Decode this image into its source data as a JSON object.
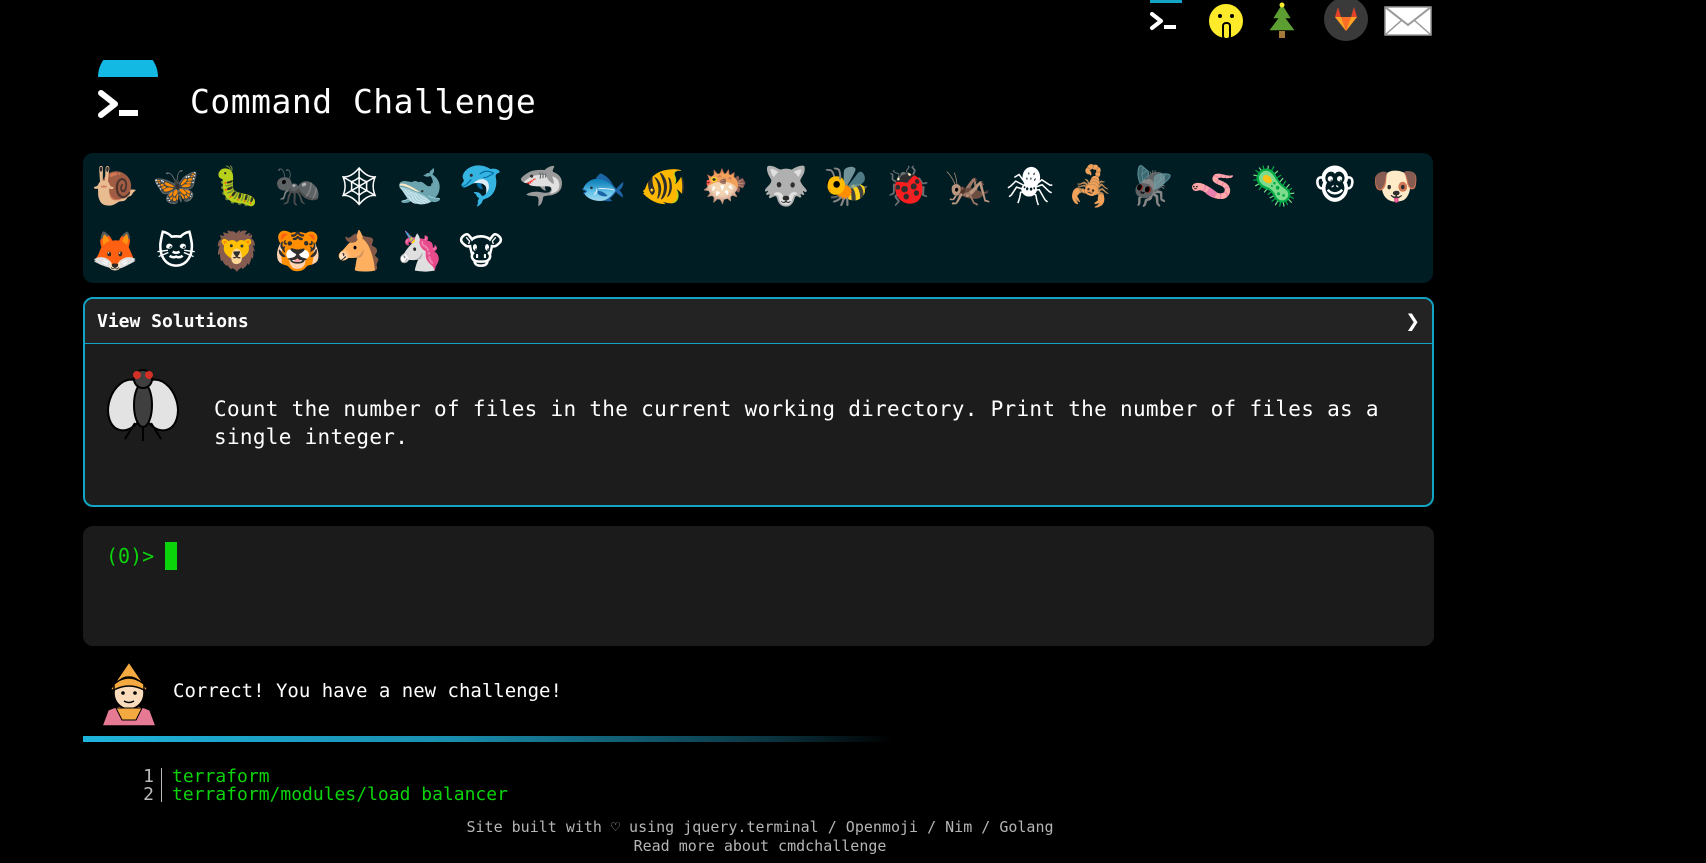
{
  "site": {
    "title": "Command Challenge"
  },
  "topnav": [
    {
      "name": "terminal-icon",
      "glyph": ""
    },
    {
      "name": "shushing-face-icon",
      "glyph": "🤭"
    },
    {
      "name": "christmas-tree-icon",
      "glyph": "🎄"
    },
    {
      "name": "gitlab-icon",
      "glyph": ""
    },
    {
      "name": "envelope-icon",
      "glyph": "✉"
    }
  ],
  "critters": [
    {
      "name": "snail-icon",
      "glyph": "🐌"
    },
    {
      "name": "butterfly-icon",
      "glyph": "🦋"
    },
    {
      "name": "caterpillar-icon",
      "glyph": "🐛"
    },
    {
      "name": "ant-icon",
      "glyph": "🐜"
    },
    {
      "name": "spider-web-icon",
      "glyph": "🕸"
    },
    {
      "name": "whale-icon",
      "glyph": "🐋"
    },
    {
      "name": "dolphin-icon",
      "glyph": "🐬"
    },
    {
      "name": "shark-icon",
      "glyph": "🦈"
    },
    {
      "name": "fish-icon",
      "glyph": "🐟"
    },
    {
      "name": "tropical-fish-icon",
      "glyph": "🐠"
    },
    {
      "name": "blowfish-icon",
      "glyph": "🐡"
    },
    {
      "name": "wolf-icon",
      "glyph": "🐺"
    },
    {
      "name": "bee-icon",
      "glyph": "🐝"
    },
    {
      "name": "ladybug-icon",
      "glyph": "🐞"
    },
    {
      "name": "cricket-icon",
      "glyph": "🦗"
    },
    {
      "name": "spider-icon",
      "glyph": "🕷"
    },
    {
      "name": "scorpion-icon",
      "glyph": "🦂"
    },
    {
      "name": "fly-icon",
      "glyph": "🪰"
    },
    {
      "name": "worm-icon",
      "glyph": "🪱"
    },
    {
      "name": "microbe-icon",
      "glyph": "🦠"
    },
    {
      "name": "monkey-icon",
      "glyph": "🐵"
    },
    {
      "name": "dog-icon",
      "glyph": "🐶"
    },
    {
      "name": "fox-icon",
      "glyph": "🦊"
    },
    {
      "name": "cat-icon",
      "glyph": "🐱"
    },
    {
      "name": "lion-icon",
      "glyph": "🦁"
    },
    {
      "name": "tiger-icon",
      "glyph": "🐯"
    },
    {
      "name": "horse-icon",
      "glyph": "🐴"
    },
    {
      "name": "unicorn-icon",
      "glyph": "🦄"
    },
    {
      "name": "cow-icon",
      "glyph": "🐮"
    }
  ],
  "challenge": {
    "header": "View Solutions",
    "chevron": "❯",
    "icon": "fly-icon",
    "description": "Count the number of files in the current working directory. Print the number of files as a single integer."
  },
  "terminal": {
    "prompt": "(0)>"
  },
  "notification": {
    "avatar": "elf-icon",
    "message": "Correct! You have a new challenge!",
    "progress": 0.66
  },
  "listing": [
    {
      "n": "1",
      "text": "terraform"
    },
    {
      "n": "2",
      "text": "terraform/modules/load_balancer"
    }
  ],
  "footer": {
    "prefix": "Site built with ♡ using",
    "links": [
      "jquery.terminal",
      "Openmoji",
      "Nim",
      "Golang"
    ],
    "separator": "/",
    "line2": "Read more about cmdchallenge"
  },
  "colors": {
    "accent": "#13a3c4",
    "terminal_green": "#0bd40b",
    "critter_bg": "#011d24"
  }
}
